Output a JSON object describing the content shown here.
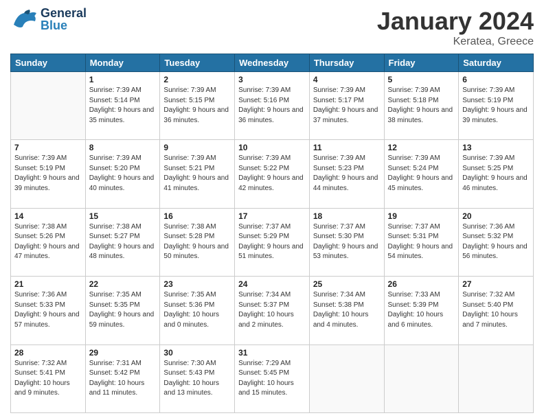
{
  "header": {
    "logo_general": "General",
    "logo_blue": "Blue",
    "month_title": "January 2024",
    "location": "Keratea, Greece"
  },
  "weekdays": [
    "Sunday",
    "Monday",
    "Tuesday",
    "Wednesday",
    "Thursday",
    "Friday",
    "Saturday"
  ],
  "weeks": [
    [
      {
        "day": "",
        "sunrise": "",
        "sunset": "",
        "daylight": ""
      },
      {
        "day": "1",
        "sunrise": "Sunrise: 7:39 AM",
        "sunset": "Sunset: 5:14 PM",
        "daylight": "Daylight: 9 hours and 35 minutes."
      },
      {
        "day": "2",
        "sunrise": "Sunrise: 7:39 AM",
        "sunset": "Sunset: 5:15 PM",
        "daylight": "Daylight: 9 hours and 36 minutes."
      },
      {
        "day": "3",
        "sunrise": "Sunrise: 7:39 AM",
        "sunset": "Sunset: 5:16 PM",
        "daylight": "Daylight: 9 hours and 36 minutes."
      },
      {
        "day": "4",
        "sunrise": "Sunrise: 7:39 AM",
        "sunset": "Sunset: 5:17 PM",
        "daylight": "Daylight: 9 hours and 37 minutes."
      },
      {
        "day": "5",
        "sunrise": "Sunrise: 7:39 AM",
        "sunset": "Sunset: 5:18 PM",
        "daylight": "Daylight: 9 hours and 38 minutes."
      },
      {
        "day": "6",
        "sunrise": "Sunrise: 7:39 AM",
        "sunset": "Sunset: 5:19 PM",
        "daylight": "Daylight: 9 hours and 39 minutes."
      }
    ],
    [
      {
        "day": "7",
        "sunrise": "Sunrise: 7:39 AM",
        "sunset": "Sunset: 5:19 PM",
        "daylight": "Daylight: 9 hours and 39 minutes."
      },
      {
        "day": "8",
        "sunrise": "Sunrise: 7:39 AM",
        "sunset": "Sunset: 5:20 PM",
        "daylight": "Daylight: 9 hours and 40 minutes."
      },
      {
        "day": "9",
        "sunrise": "Sunrise: 7:39 AM",
        "sunset": "Sunset: 5:21 PM",
        "daylight": "Daylight: 9 hours and 41 minutes."
      },
      {
        "day": "10",
        "sunrise": "Sunrise: 7:39 AM",
        "sunset": "Sunset: 5:22 PM",
        "daylight": "Daylight: 9 hours and 42 minutes."
      },
      {
        "day": "11",
        "sunrise": "Sunrise: 7:39 AM",
        "sunset": "Sunset: 5:23 PM",
        "daylight": "Daylight: 9 hours and 44 minutes."
      },
      {
        "day": "12",
        "sunrise": "Sunrise: 7:39 AM",
        "sunset": "Sunset: 5:24 PM",
        "daylight": "Daylight: 9 hours and 45 minutes."
      },
      {
        "day": "13",
        "sunrise": "Sunrise: 7:39 AM",
        "sunset": "Sunset: 5:25 PM",
        "daylight": "Daylight: 9 hours and 46 minutes."
      }
    ],
    [
      {
        "day": "14",
        "sunrise": "Sunrise: 7:38 AM",
        "sunset": "Sunset: 5:26 PM",
        "daylight": "Daylight: 9 hours and 47 minutes."
      },
      {
        "day": "15",
        "sunrise": "Sunrise: 7:38 AM",
        "sunset": "Sunset: 5:27 PM",
        "daylight": "Daylight: 9 hours and 48 minutes."
      },
      {
        "day": "16",
        "sunrise": "Sunrise: 7:38 AM",
        "sunset": "Sunset: 5:28 PM",
        "daylight": "Daylight: 9 hours and 50 minutes."
      },
      {
        "day": "17",
        "sunrise": "Sunrise: 7:37 AM",
        "sunset": "Sunset: 5:29 PM",
        "daylight": "Daylight: 9 hours and 51 minutes."
      },
      {
        "day": "18",
        "sunrise": "Sunrise: 7:37 AM",
        "sunset": "Sunset: 5:30 PM",
        "daylight": "Daylight: 9 hours and 53 minutes."
      },
      {
        "day": "19",
        "sunrise": "Sunrise: 7:37 AM",
        "sunset": "Sunset: 5:31 PM",
        "daylight": "Daylight: 9 hours and 54 minutes."
      },
      {
        "day": "20",
        "sunrise": "Sunrise: 7:36 AM",
        "sunset": "Sunset: 5:32 PM",
        "daylight": "Daylight: 9 hours and 56 minutes."
      }
    ],
    [
      {
        "day": "21",
        "sunrise": "Sunrise: 7:36 AM",
        "sunset": "Sunset: 5:33 PM",
        "daylight": "Daylight: 9 hours and 57 minutes."
      },
      {
        "day": "22",
        "sunrise": "Sunrise: 7:35 AM",
        "sunset": "Sunset: 5:35 PM",
        "daylight": "Daylight: 9 hours and 59 minutes."
      },
      {
        "day": "23",
        "sunrise": "Sunrise: 7:35 AM",
        "sunset": "Sunset: 5:36 PM",
        "daylight": "Daylight: 10 hours and 0 minutes."
      },
      {
        "day": "24",
        "sunrise": "Sunrise: 7:34 AM",
        "sunset": "Sunset: 5:37 PM",
        "daylight": "Daylight: 10 hours and 2 minutes."
      },
      {
        "day": "25",
        "sunrise": "Sunrise: 7:34 AM",
        "sunset": "Sunset: 5:38 PM",
        "daylight": "Daylight: 10 hours and 4 minutes."
      },
      {
        "day": "26",
        "sunrise": "Sunrise: 7:33 AM",
        "sunset": "Sunset: 5:39 PM",
        "daylight": "Daylight: 10 hours and 6 minutes."
      },
      {
        "day": "27",
        "sunrise": "Sunrise: 7:32 AM",
        "sunset": "Sunset: 5:40 PM",
        "daylight": "Daylight: 10 hours and 7 minutes."
      }
    ],
    [
      {
        "day": "28",
        "sunrise": "Sunrise: 7:32 AM",
        "sunset": "Sunset: 5:41 PM",
        "daylight": "Daylight: 10 hours and 9 minutes."
      },
      {
        "day": "29",
        "sunrise": "Sunrise: 7:31 AM",
        "sunset": "Sunset: 5:42 PM",
        "daylight": "Daylight: 10 hours and 11 minutes."
      },
      {
        "day": "30",
        "sunrise": "Sunrise: 7:30 AM",
        "sunset": "Sunset: 5:43 PM",
        "daylight": "Daylight: 10 hours and 13 minutes."
      },
      {
        "day": "31",
        "sunrise": "Sunrise: 7:29 AM",
        "sunset": "Sunset: 5:45 PM",
        "daylight": "Daylight: 10 hours and 15 minutes."
      },
      {
        "day": "",
        "sunrise": "",
        "sunset": "",
        "daylight": ""
      },
      {
        "day": "",
        "sunrise": "",
        "sunset": "",
        "daylight": ""
      },
      {
        "day": "",
        "sunrise": "",
        "sunset": "",
        "daylight": ""
      }
    ]
  ]
}
